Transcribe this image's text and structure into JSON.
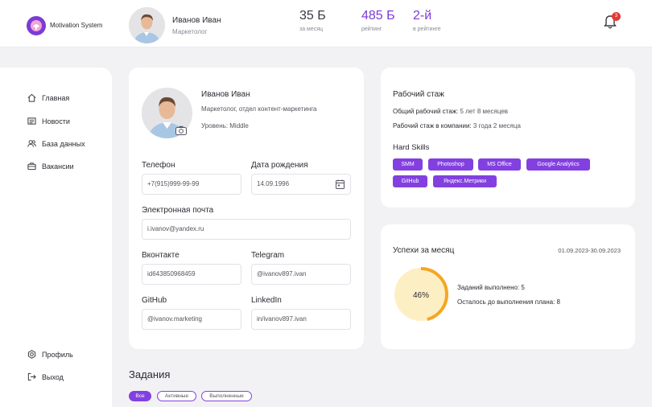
{
  "app": {
    "name": "Motivation System"
  },
  "header": {
    "user_name": "Иванов Иван",
    "user_role": "Маркетолог",
    "stats": [
      {
        "value": "35 Б",
        "label": "за месяц"
      },
      {
        "value": "485 Б",
        "label": "рейтинг"
      },
      {
        "value": "2-й",
        "label": "в рейтинге"
      }
    ],
    "notifications_count": "3"
  },
  "sidebar": {
    "items": [
      {
        "label": "Главная",
        "icon": "home-icon"
      },
      {
        "label": "Новости",
        "icon": "news-icon"
      },
      {
        "label": "База данных",
        "icon": "users-icon"
      },
      {
        "label": "Вакансии",
        "icon": "briefcase-icon"
      }
    ],
    "bottom": [
      {
        "label": "Профиль",
        "icon": "gear-icon"
      },
      {
        "label": "Выход",
        "icon": "logout-icon"
      }
    ]
  },
  "profile": {
    "name": "Иванов Иван",
    "position": "Маркетолог, отдел контент-маркетинга",
    "level": "Уровень: Middle",
    "fields": {
      "phone": {
        "label": "Телефон",
        "value": "+7(915)999-99-99"
      },
      "birthdate": {
        "label": "Дата рождения",
        "value": "14.09.1996"
      },
      "email": {
        "label": "Электронная почта",
        "value": "i.ivanov@yandex.ru"
      },
      "vk": {
        "label": "Вконтакте",
        "value": "id643850968459"
      },
      "telegram": {
        "label": "Telegram",
        "value": "@ivanov897.ivan"
      },
      "github": {
        "label": "GitHub",
        "value": "@ivanov.marketing"
      },
      "linkedin": {
        "label": "LinkedIn",
        "value": "in/ivanov897.ivan"
      }
    }
  },
  "experience": {
    "title": "Рабочий стаж",
    "total_label": "Общий рабочий стаж:",
    "total_value": "5 лет 8 месяцев",
    "company_label": "Рабочий стаж в компании:",
    "company_value": "3 года 2 месяца",
    "skills_title": "Hard Skills",
    "skills": [
      "SMM",
      "Photoshop",
      "MS Office",
      "Google Analytics",
      "GitHub",
      "Яндекс.Метрики"
    ]
  },
  "success": {
    "title": "Успехи за месяц",
    "period": "01.09.2023-30.09.2023",
    "percent_label": "46%",
    "progress": 0.46,
    "done": "Заданий выполнено: 5",
    "remaining": "Осталось до выполнения плана: 8"
  },
  "tasks": {
    "title": "Задания",
    "filters": [
      "Все",
      "Активные",
      "Выполненные"
    ]
  },
  "colors": {
    "accent": "#8340e0",
    "progress": "#f5a623",
    "progress_bg": "#fdefc4",
    "badge": "#e53935"
  }
}
